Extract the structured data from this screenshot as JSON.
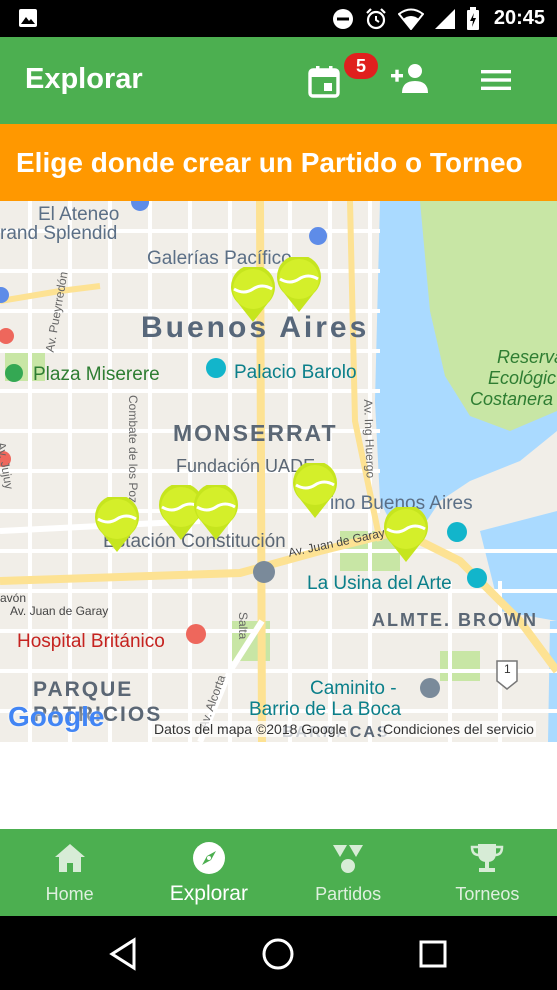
{
  "status_bar": {
    "time": "20:45"
  },
  "app_bar": {
    "title": "Explorar",
    "badge_count": "5",
    "icons": [
      "calendar-icon",
      "add-user-icon",
      "menu-icon"
    ]
  },
  "banner": {
    "text": "Elige donde crear un Partido o Torneo"
  },
  "map": {
    "labels": {
      "ateneo": "El Ateneo",
      "splendid": "rand Splendid",
      "galerias": "Galerías Pacífico",
      "pueyrredon": "Av. Pueyrredón",
      "buenos_aires": "Buenos Aires",
      "plaza_miserere": "Plaza Miserere",
      "palacio_barolo": "Palacio Barolo",
      "reserva": "Reserva",
      "ecologica": "Ecológic",
      "costanera": "Costanera",
      "monserrat": "MONSERRAT",
      "jujuy": "Av. Jujuy",
      "combate": "Combate de los Pozos",
      "ing_huergo": "Av. Ing Huergo",
      "fundacion": "Fundación UADE",
      "luna_park": "ino Buenos Aires",
      "constitucion": "Estación Constitución",
      "juan_garay": "Av. Juan de Garay",
      "usina": "La Usina del Arte",
      "juan_garay2": "Av. Juan de Garay",
      "avon": "avón",
      "almte_brown": "ALMTE. BROWN",
      "hospital": "Hospital Británico",
      "salta": "Salta",
      "caminito": "Caminito -",
      "parque": "PARQUE",
      "patricios": "PATRICIOS",
      "alcorta": "Av. Alcorta",
      "barrio": "Barrio de La Boca",
      "barracas": "BARRACAS",
      "route": "1"
    },
    "google_logo": "Google",
    "attribution": "Datos del mapa ©2018 Google",
    "terms": "Condiciones del servicio",
    "pins": 8
  },
  "bottom_nav": {
    "items": [
      {
        "label": "Home",
        "icon": "home-icon",
        "active": false
      },
      {
        "label": "Explorar",
        "icon": "compass-icon",
        "active": true
      },
      {
        "label": "Partidos",
        "icon": "partidos-icon",
        "active": false
      },
      {
        "label": "Torneos",
        "icon": "trophy-icon",
        "active": false
      }
    ]
  },
  "colors": {
    "primary": "#4caf50",
    "banner": "#ff9800",
    "badge": "#e0201e",
    "pin": "#c6e51e"
  }
}
